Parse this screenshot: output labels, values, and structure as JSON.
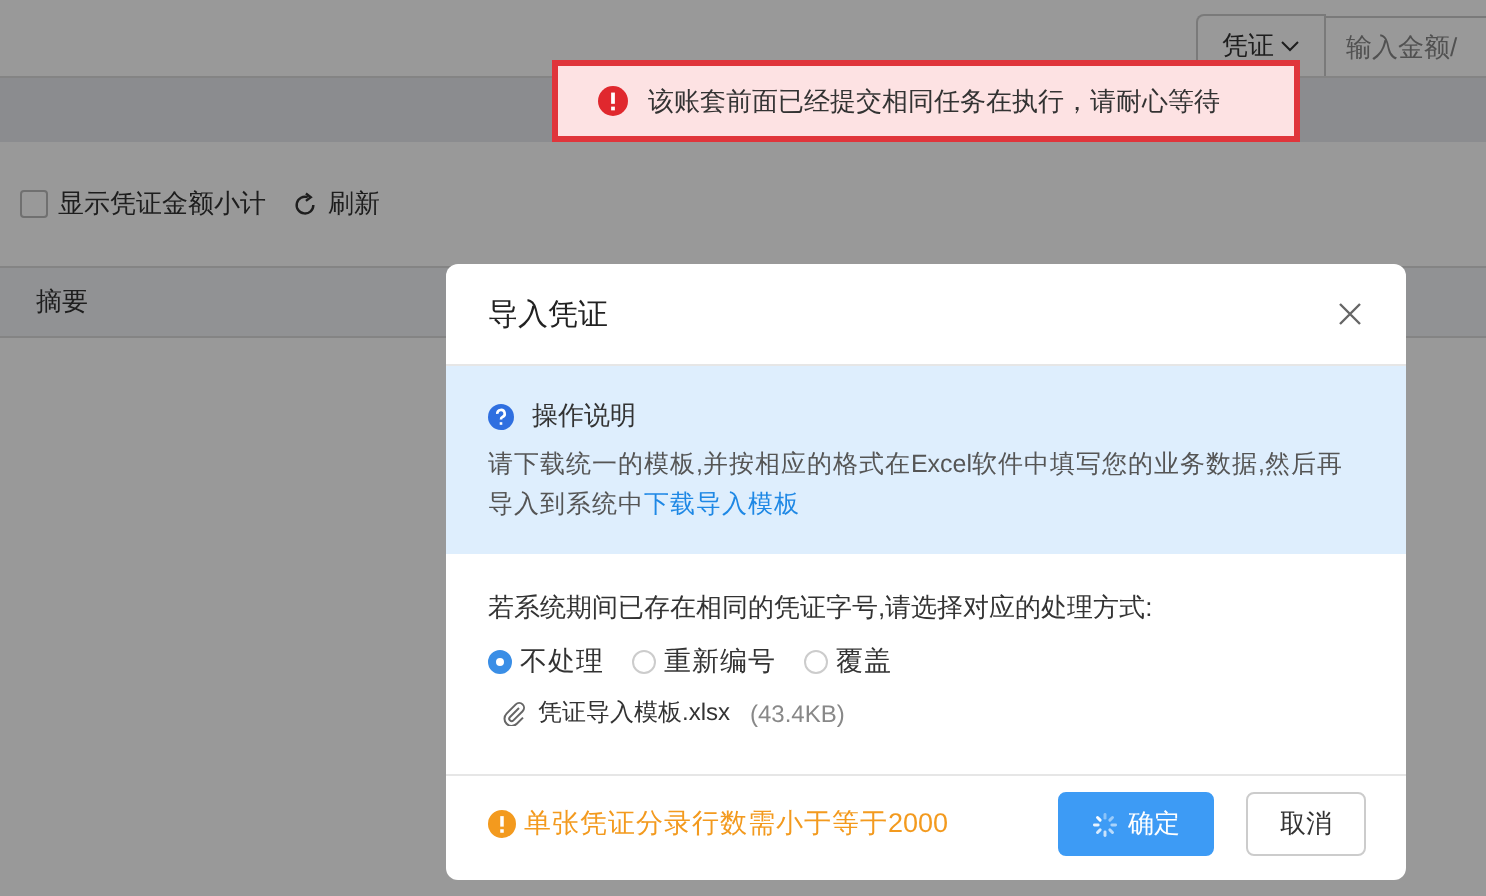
{
  "top_bar": {
    "voucher_select": "凭证",
    "search": {
      "placeholder": "输入金额/"
    }
  },
  "toolbar": {
    "subtotal_checkbox": {
      "label": "显示凭证金额小计",
      "checked": false
    },
    "refresh": "刷新"
  },
  "table": {
    "columns": [
      "摘要"
    ]
  },
  "toast": {
    "kind": "error",
    "text": "该账套前面已经提交相同任务在执行，请耐心等待"
  },
  "dialog": {
    "title": "导入凭证",
    "info": {
      "title": "操作说明",
      "text": "请下载统一的模板,并按相应的格式在Excel软件中填写您的业务数据,然后再导入到系统中",
      "link": "下载导入模板"
    },
    "question": "若系统期间已存在相同的凭证字号,请选择对应的处理方式:",
    "options": [
      {
        "label": "不处理",
        "selected": true
      },
      {
        "label": "重新编号",
        "selected": false
      },
      {
        "label": "覆盖",
        "selected": false
      }
    ],
    "file": {
      "name": "凭证导入模板.xlsx",
      "size": "(43.4KB)"
    },
    "warning": "单张凭证分录行数需小于等于2000",
    "buttons": [
      {
        "kind": "primary",
        "label": "确定"
      },
      {
        "kind": "default",
        "label": "取消"
      }
    ]
  }
}
